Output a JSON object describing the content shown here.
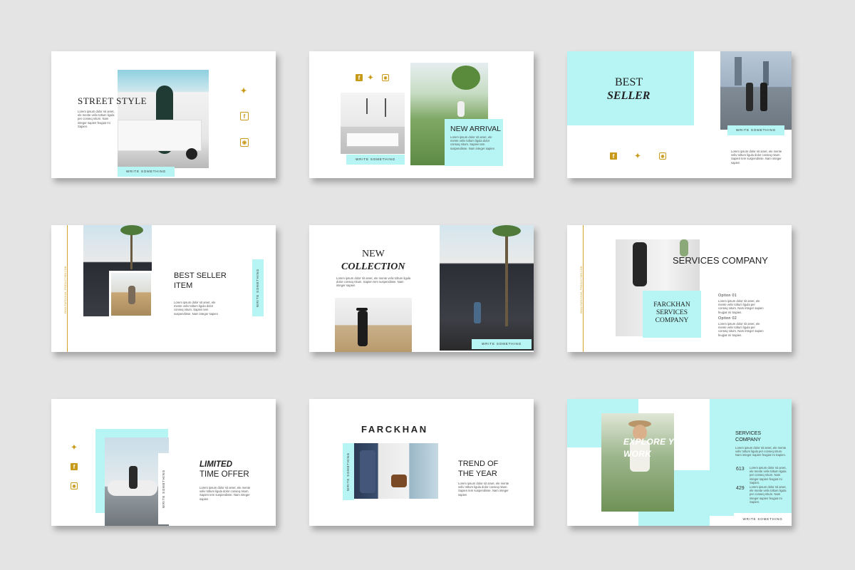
{
  "common": {
    "tag": "WRITE SOMETHING",
    "lorem_a": "Lorem ipsum dolor sit amet, ele mente veliv toltum ligula per conseq nitum. Nam integer sapien feugiat mi Sapien.",
    "lorem_b": "Lorem ipsum dolor sit amet, ele mente veliv toltum ligula dolor conseq nitum. Sapien tem suspendisse. Nam integer sapien",
    "url": "WWW.FARCKHAN_PRODUCTION.COM"
  },
  "colors": {
    "mint": "#b6f5f3",
    "gold": "#c89a1a",
    "bg": "#e4e4e4"
  },
  "icons": [
    "twitter-icon",
    "facebook-icon",
    "instagram-icon"
  ],
  "slides": {
    "s1": {
      "title": "STREET STYLE"
    },
    "s2": {
      "title": "NEW ARRIVAL"
    },
    "s3": {
      "title_line1": "BEST",
      "title_line2": "SELLER"
    },
    "s4": {
      "title_line1": "BEST SELLER",
      "title_line2": "ITEM"
    },
    "s5": {
      "title_line1": "NEW",
      "title_line2": "COLLECTION"
    },
    "s6": {
      "title": "SERVICES COMPANY",
      "box_line1": "FARCKHAN",
      "box_line2": "SERVICES",
      "box_line3": "COMPANY",
      "option1": "Option 01",
      "option2": "Option 02"
    },
    "s7": {
      "title_line1": "LIMITED",
      "title_line2": "TIME OFFER"
    },
    "s8": {
      "title": "FARCKHAN",
      "sub_line1": "TREND OF",
      "sub_line2": "THE YEAR"
    },
    "s9": {
      "title_line1": "EXPLORE YOUR",
      "title_line2": "WORK",
      "side_line1": "SERVICES",
      "side_line2": "COMPANY",
      "num1": "613",
      "num2": "429"
    }
  }
}
